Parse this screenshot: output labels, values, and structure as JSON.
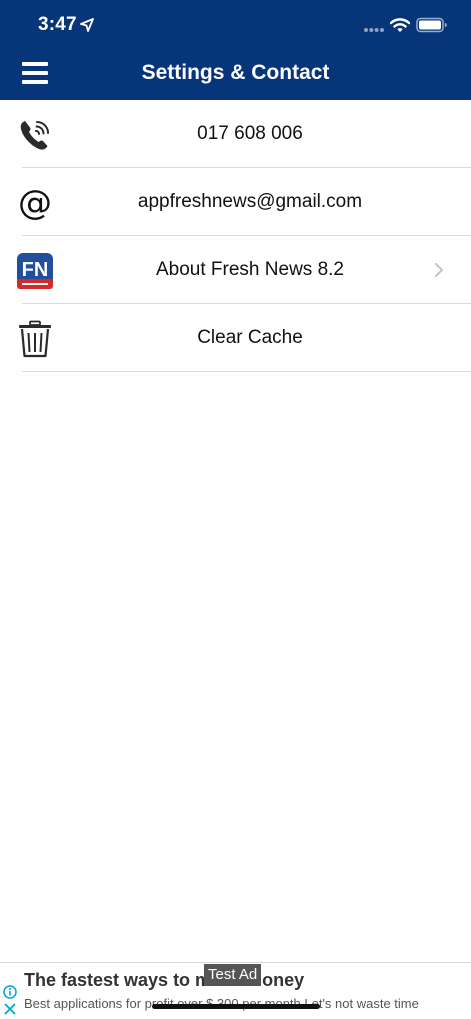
{
  "status_bar": {
    "time": "3:47",
    "icons": [
      "location-arrow-icon",
      "cellular-signal-icon",
      "wifi-icon",
      "battery-icon"
    ]
  },
  "header": {
    "title": "Settings & Contact",
    "menu_icon": "hamburger-menu-icon",
    "background_color": "#06357a"
  },
  "items": [
    {
      "icon": "phone-icon",
      "label": "017 608 006"
    },
    {
      "icon": "at-sign-icon",
      "label": "appfreshnews@gmail.com"
    },
    {
      "icon": "fresh-news-logo-icon",
      "label": "About Fresh News 8.2",
      "has_chevron": true
    },
    {
      "icon": "trash-icon",
      "label": "Clear Cache"
    }
  ],
  "ad": {
    "badge": "Test Ad",
    "headline": "The fastest ways to make money",
    "subline": "Best applications for profit over $ 300 per month Let's not waste time",
    "icons": [
      "ad-info-icon",
      "ad-close-icon"
    ]
  }
}
